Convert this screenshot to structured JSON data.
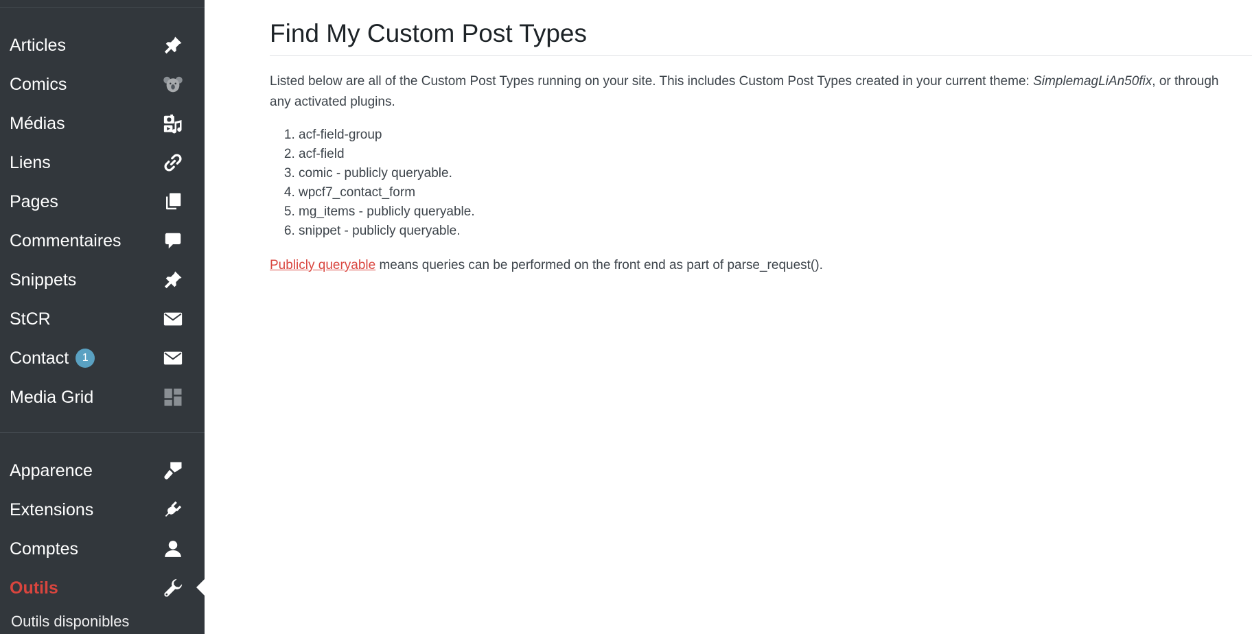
{
  "sidebar": {
    "items": [
      {
        "label": "Articles",
        "icon": "pin-icon"
      },
      {
        "label": "Comics",
        "icon": "koala-icon"
      },
      {
        "label": "Médias",
        "icon": "media-icon"
      },
      {
        "label": "Liens",
        "icon": "link-icon"
      },
      {
        "label": "Pages",
        "icon": "pages-icon"
      },
      {
        "label": "Commentaires",
        "icon": "comment-icon"
      },
      {
        "label": "Snippets",
        "icon": "pin-icon"
      },
      {
        "label": "StCR",
        "icon": "envelope-icon"
      },
      {
        "label": "Contact",
        "icon": "envelope-icon",
        "badge": "1"
      },
      {
        "label": "Media Grid",
        "icon": "grid-icon"
      }
    ],
    "admin_items": [
      {
        "label": "Apparence",
        "icon": "paintbrush-icon"
      },
      {
        "label": "Extensions",
        "icon": "plugin-icon"
      },
      {
        "label": "Comptes",
        "icon": "user-icon"
      },
      {
        "label": "Outils",
        "icon": "wrench-icon",
        "current": true
      }
    ],
    "submenu": {
      "label": "Outils disponibles"
    }
  },
  "main": {
    "title": "Find My Custom Post Types",
    "intro_before": "Listed below are all of the Custom Post Types running on your site. This includes Custom Post Types created in your current theme: ",
    "theme_name": "SimplemagLiAn50fix",
    "intro_after": ", or through any activated plugins.",
    "post_types": [
      "acf-field-group",
      "acf-field",
      "comic - publicly queryable.",
      "wpcf7_contact_form",
      "mg_items - publicly queryable.",
      "snippet - publicly queryable."
    ],
    "note_link": "Publicly queryable",
    "note_text": " means queries can be performed on the front end as part of parse_request()."
  },
  "colors": {
    "sidebar_bg": "#32373c",
    "accent_red": "#d9453e",
    "badge_blue": "#5aa1c2",
    "text": "#3c434a"
  }
}
